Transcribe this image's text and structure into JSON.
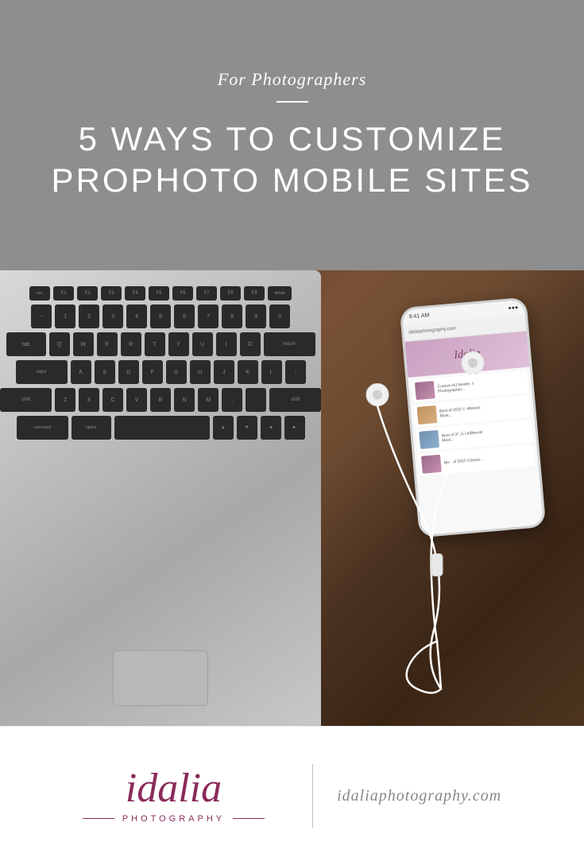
{
  "header": {
    "subtitle": "For Photographers",
    "divider": "—",
    "title_line1": "5 WAYS TO CUSTOMIZE",
    "title_line2": "PROPHOTO MOBILE SITES",
    "bg_color": "#8e8e8e"
  },
  "phone": {
    "status_bar": "9:41 AM",
    "browser_url": "idaliaphotography.com",
    "logo": "Idalia",
    "posts": [
      {
        "text": "Custom NJ Newborn Photographer...",
        "thumb_class": "thumb-purple"
      },
      {
        "text": "Best of 2015 Unfiltered: Most...",
        "thumb_class": "thumb-warm"
      },
      {
        "text": "Best of 2015 Unfiltered: Most...",
        "thumb_class": "thumb-cool"
      },
      {
        "text": "Best of 2015 Classic...",
        "thumb_class": "thumb-purple"
      }
    ]
  },
  "footer": {
    "logo_name": "idalia",
    "logo_subtext": "PHOTOGRAPHY",
    "website": "idaliaphotography.com",
    "accent_color": "#8a2a5a"
  }
}
